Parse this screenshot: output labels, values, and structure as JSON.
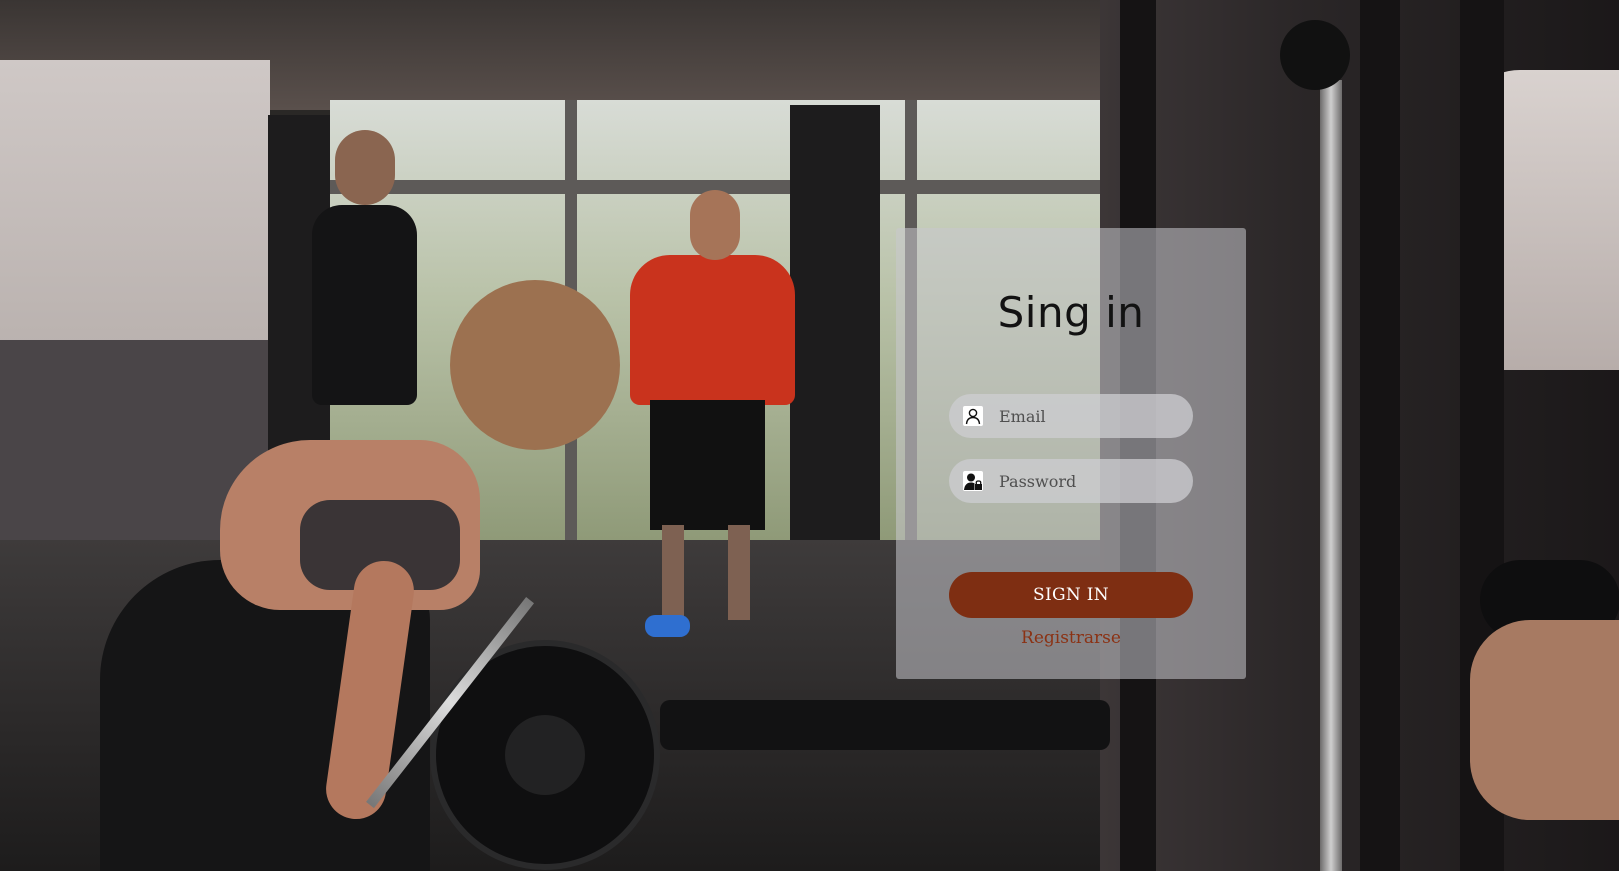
{
  "colors": {
    "card_background": "#c8c8ce",
    "button_background": "#7e2e12",
    "button_text": "#ffffff",
    "link_text": "#8b3214",
    "title_text": "#121212"
  },
  "background": {
    "description_icon": "gym-photo"
  },
  "login": {
    "title": "Sing in",
    "email": {
      "placeholder": "Email",
      "value": "",
      "icon": "user-icon"
    },
    "password": {
      "placeholder": "Password",
      "value": "",
      "icon": "user-lock-icon"
    },
    "signin_label": "SIGN IN",
    "register_label": "Registrarse"
  }
}
